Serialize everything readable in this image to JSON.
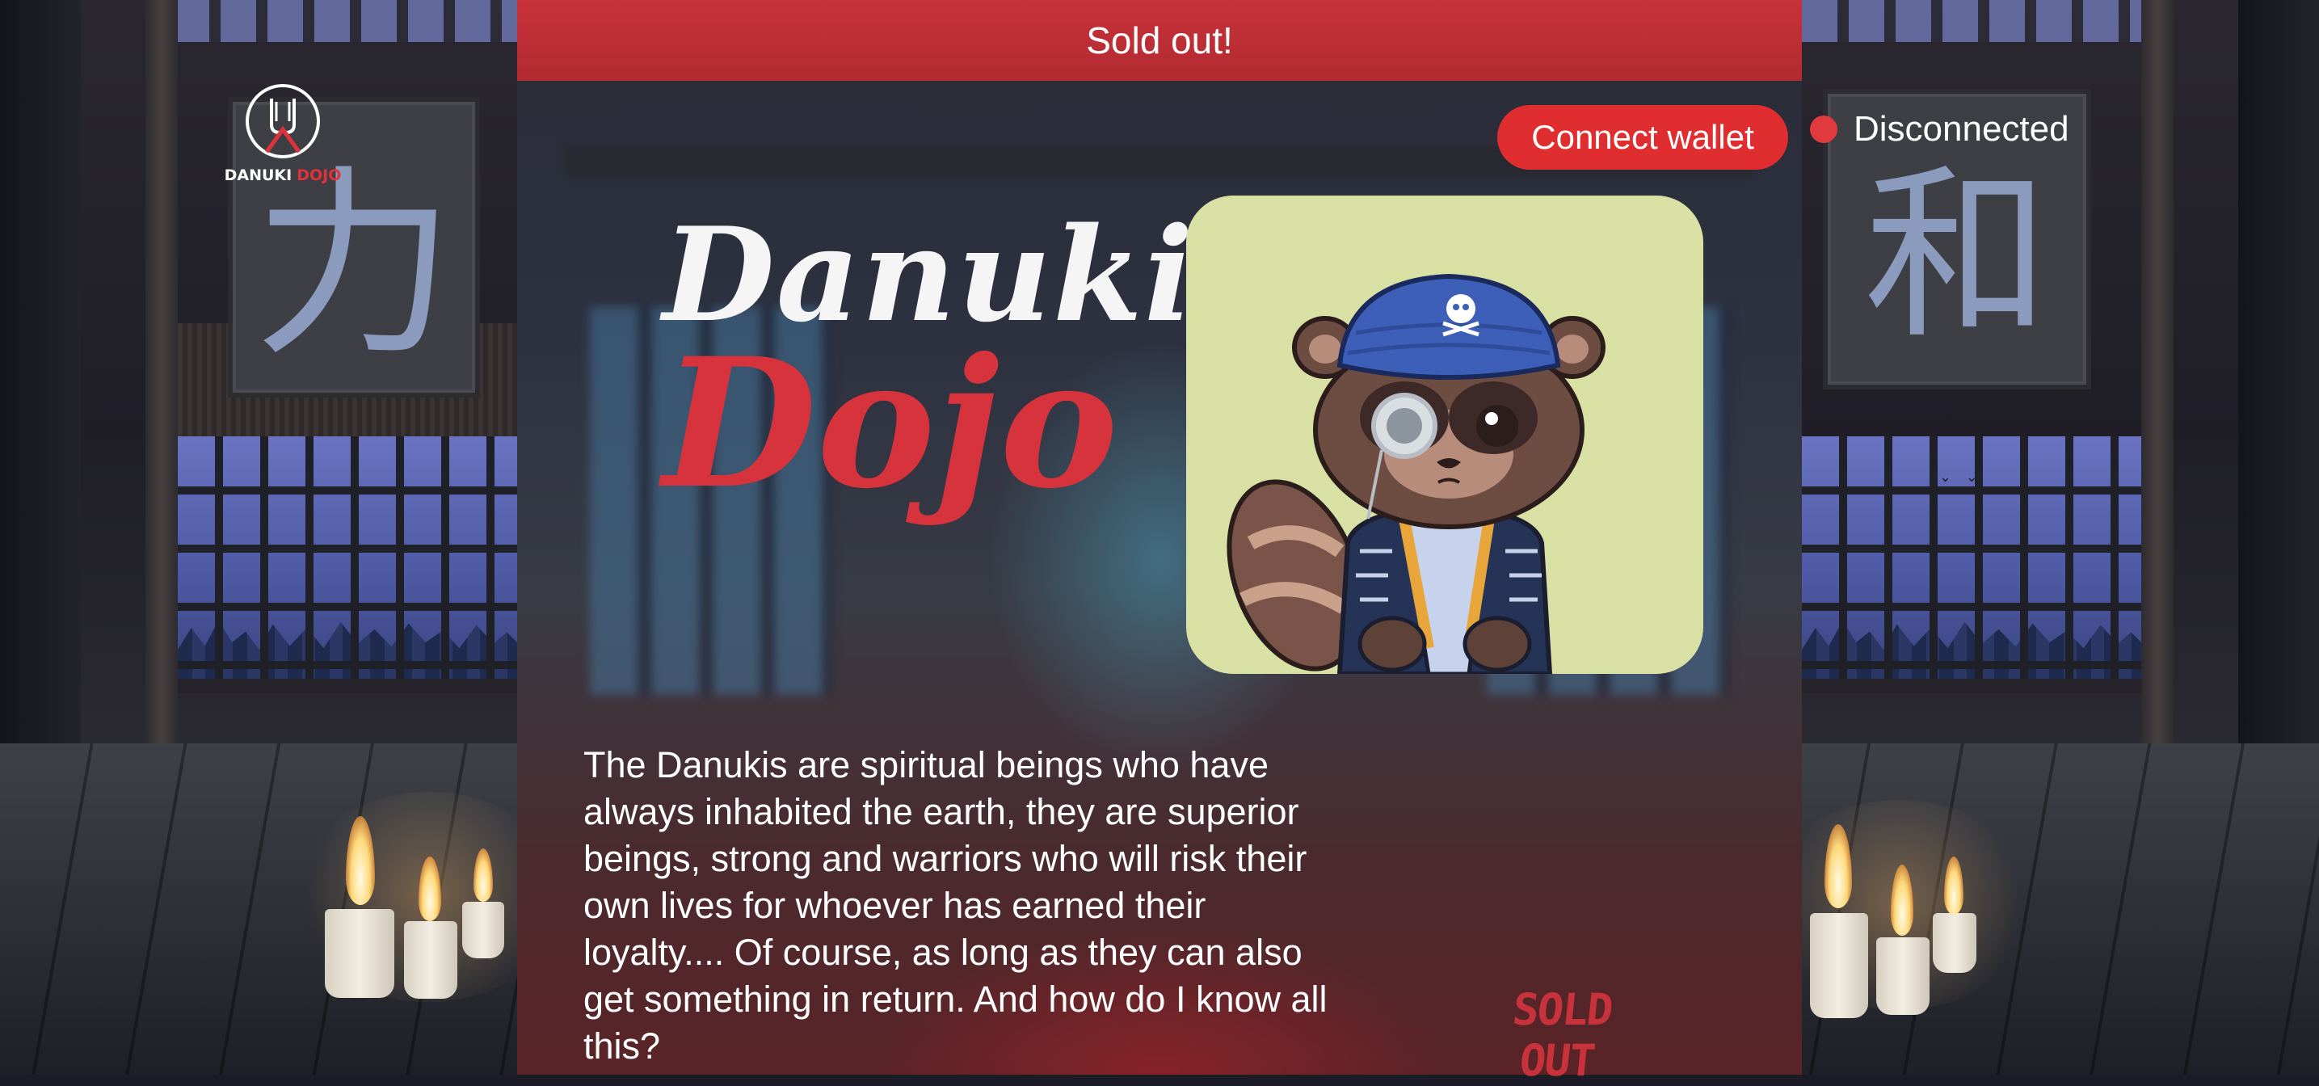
{
  "banner": {
    "text": "Sold out!"
  },
  "logo": {
    "text_white": "DANUKI",
    "text_red": "DOJO"
  },
  "header": {
    "connect_label": "Connect wallet",
    "status_text": "Disconnected",
    "status_color": "#e0393e"
  },
  "hero": {
    "title_line1": "Danuki",
    "title_line2": "Dojo",
    "title_colors": {
      "line1": "#f5f5f5",
      "line2": "#d6333c"
    }
  },
  "decor": {
    "left_kanji": "力",
    "right_kanji": "和"
  },
  "nft": {
    "icon": "tanuki-nft-icon",
    "background": "#d8e0a4"
  },
  "lore": {
    "text": "The Danukis are spiritual beings who have always inhabited the earth, they are superior beings, strong and warriors who will risk their own lives for whoever has earned their loyalty.... Of course, as long as they can also get something in return. And how do I know all this?"
  },
  "mint": {
    "sold_out_label": "SOLD OUT"
  },
  "colors": {
    "accent": "#e02d2f",
    "banner": "#c8323a"
  }
}
